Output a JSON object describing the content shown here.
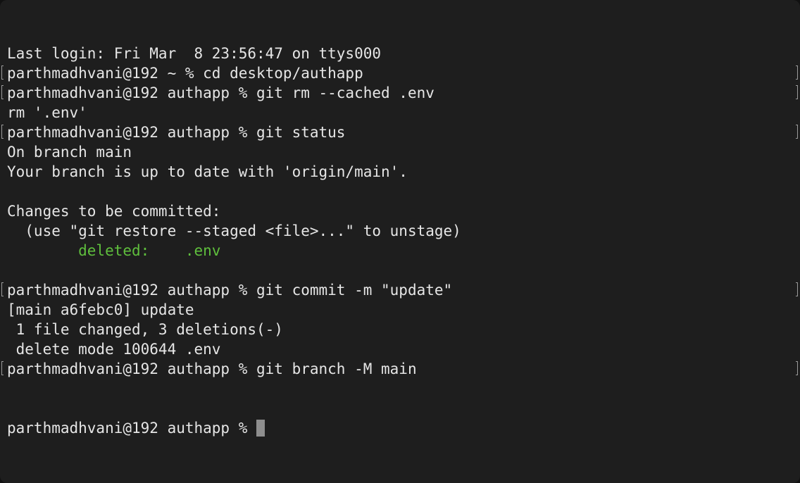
{
  "terminal": {
    "colors": {
      "background": "#1e1e1e",
      "text": "#e6e6e6",
      "git_status_deleted": "#5fbf3d",
      "cursor": "#8e8e8e"
    },
    "lines": [
      {
        "text": "Last login: Fri Mar  8 23:56:47 on ttys000",
        "marked": false
      },
      {
        "text": "parthmadhvani@192 ~ % cd desktop/authapp",
        "marked": true
      },
      {
        "text": "parthmadhvani@192 authapp % git rm --cached .env",
        "marked": true
      },
      {
        "text": "rm '.env'",
        "marked": false
      },
      {
        "text": "parthmadhvani@192 authapp % git status",
        "marked": true
      },
      {
        "text": "On branch main",
        "marked": false
      },
      {
        "text": "Your branch is up to date with 'origin/main'.",
        "marked": false
      },
      {
        "text": "",
        "marked": false
      },
      {
        "text": "Changes to be committed:",
        "marked": false
      },
      {
        "text": "  (use \"git restore --staged <file>...\" to unstage)",
        "marked": false
      },
      {
        "text": "        deleted:    .env",
        "marked": false,
        "color": "git_status_deleted"
      },
      {
        "text": "",
        "marked": false
      },
      {
        "text": "parthmadhvani@192 authapp % git commit -m \"update\"",
        "marked": true
      },
      {
        "text": "[main a6febc0] update",
        "marked": false
      },
      {
        "text": " 1 file changed, 3 deletions(-)",
        "marked": false
      },
      {
        "text": " delete mode 100644 .env",
        "marked": false
      },
      {
        "text": "parthmadhvani@192 authapp % git branch -M main",
        "marked": true
      }
    ],
    "prompt": "parthmadhvani@192 authapp % "
  }
}
